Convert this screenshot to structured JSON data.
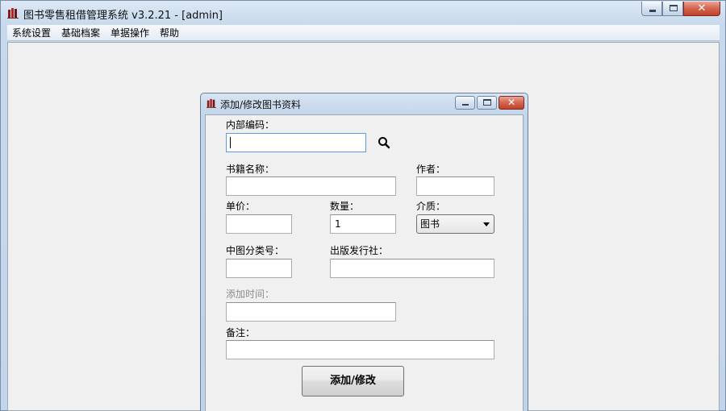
{
  "window": {
    "title": "图书零售租借管理系统  v3.2.21 - [admin]",
    "caption_close": "✕"
  },
  "menu": {
    "items": [
      "系统设置",
      "基础档案",
      "单据操作",
      "帮助"
    ]
  },
  "dialog": {
    "title": "添加/修改图书资料",
    "caption_close": "✕",
    "fields": {
      "internal_code": {
        "label": "内部编码：",
        "value": ""
      },
      "book_name": {
        "label": "书籍名称：",
        "value": ""
      },
      "author": {
        "label": "作者：",
        "value": ""
      },
      "unit_price": {
        "label": "单价：",
        "value": ""
      },
      "quantity": {
        "label": "数量：",
        "value": "1"
      },
      "medium": {
        "label": "介质：",
        "value": "图书"
      },
      "clc_number": {
        "label": "中图分类号：",
        "value": ""
      },
      "publisher": {
        "label": "出版发行社：",
        "value": ""
      },
      "added_time": {
        "label": "添加时间：",
        "value": ""
      },
      "remarks": {
        "label": "备注：",
        "value": ""
      }
    },
    "submit_label": "添加/修改"
  },
  "colors": {
    "accent_focus": "#569de5",
    "close_button": "#c2402a",
    "disabled_text": "#8d8d8d",
    "titlebar": "#c7d9ec"
  },
  "icons": {
    "app": "books-icon",
    "search": "search-icon"
  }
}
